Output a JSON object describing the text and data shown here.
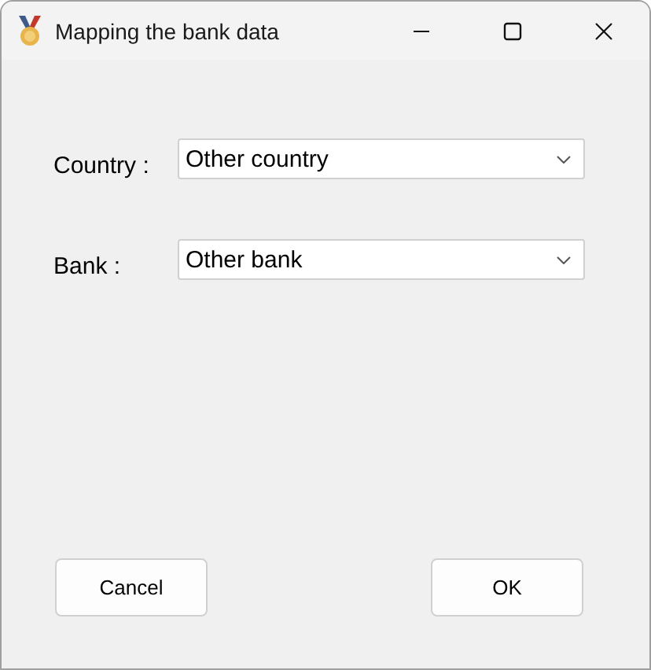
{
  "window": {
    "title": "Mapping the bank data"
  },
  "fields": [
    {
      "label": "Country :",
      "value": "Other country"
    },
    {
      "label": "Bank :",
      "value": "Other bank"
    }
  ],
  "buttons": [
    "Cancel",
    "OK"
  ]
}
